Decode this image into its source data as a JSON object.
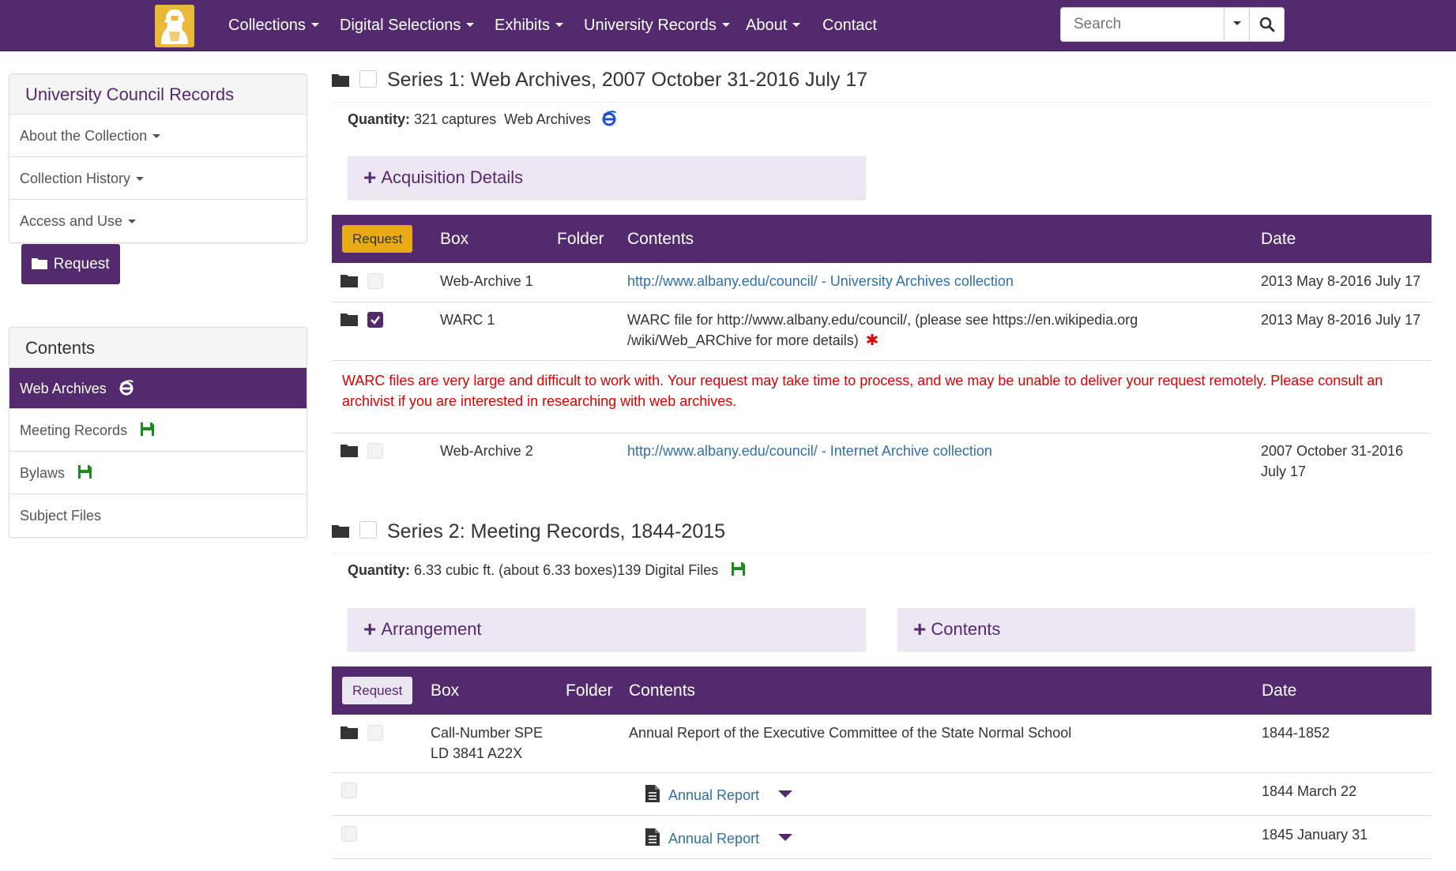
{
  "nav": {
    "items": [
      {
        "label": "Collections",
        "dropdown": true
      },
      {
        "label": "Digital Selections",
        "dropdown": true
      },
      {
        "label": "Exhibits",
        "dropdown": true
      },
      {
        "label": "University Records",
        "dropdown": true
      },
      {
        "label": "About",
        "dropdown": true
      },
      {
        "label": "Contact",
        "dropdown": false
      }
    ],
    "search_placeholder": "Search"
  },
  "sidebar": {
    "title": "University Council Records",
    "items": [
      {
        "label": "About the Collection"
      },
      {
        "label": "Collection History"
      },
      {
        "label": "Access and Use"
      }
    ],
    "request_label": "Request",
    "contents_title": "Contents",
    "contents_items": [
      {
        "label": "Web Archives",
        "icon": "ie-icon",
        "active": true
      },
      {
        "label": "Meeting Records",
        "icon": "floppy-disk-icon"
      },
      {
        "label": "Bylaws",
        "icon": "floppy-disk-icon"
      },
      {
        "label": "Subject Files"
      }
    ]
  },
  "series1": {
    "title": "Series 1: Web Archives, 2007 October 31-2016 July 17",
    "quantity_label": "Quantity:",
    "quantity_value": "321 captures",
    "quantity_extra": "Web Archives",
    "acquisition_label": "Acquisition Details",
    "table": {
      "headers": {
        "request": "Request",
        "box": "Box",
        "folder": "Folder",
        "contents": "Contents",
        "date": "Date"
      },
      "rows": [
        {
          "box": "Web-Archive 1",
          "contents": "http://www.albany.edu/council/ - University Archives collection",
          "date": "2013 May 8-2016 July 17"
        },
        {
          "box": "WARC 1",
          "contents_line1": "WARC file for http://www.albany.edu/council/, (please see https://en.wikipedia.org",
          "contents_line2": "/wiki/Web_ARChive for more details)",
          "date": "2013 May 8-2016 July 17"
        },
        {
          "box": "Web-Archive 2",
          "contents": "http://www.albany.edu/council/ - Internet Archive collection",
          "date_line1": "2007 October 31-2016",
          "date_line2": "July 17"
        }
      ],
      "warning_line1": "WARC files are very large and difficult to work with. Your request may take time to process, and we may be unable to deliver your request remotely. Please consult an",
      "warning_line2": "archivist if you are interested in researching with web archives."
    }
  },
  "series2": {
    "title": "Series 2: Meeting Records, 1844-2015",
    "quantity_label": "Quantity:",
    "quantity_value": "6.33 cubic ft. (about 6.33 boxes)139 Digital Files",
    "arrangement_label": "Arrangement",
    "contents_label": "Contents",
    "table": {
      "headers": {
        "request": "Request",
        "box": "Box",
        "folder": "Folder",
        "contents": "Contents",
        "date": "Date"
      },
      "rows": [
        {
          "box_line1": "Call-Number SPE",
          "box_line2": "LD 3841 A22X",
          "contents": "Annual Report of the Executive Committee of the State Normal School",
          "date": "1844-1852"
        },
        {
          "contents": "Annual Report",
          "date": "1844 March 22"
        },
        {
          "contents": "Annual Report",
          "date": "1845 January 31"
        }
      ]
    }
  },
  "colors": {
    "brand": "#532a6e",
    "gold": "#e8ab13",
    "link": "#2f6fad",
    "warning": "#e00000"
  }
}
